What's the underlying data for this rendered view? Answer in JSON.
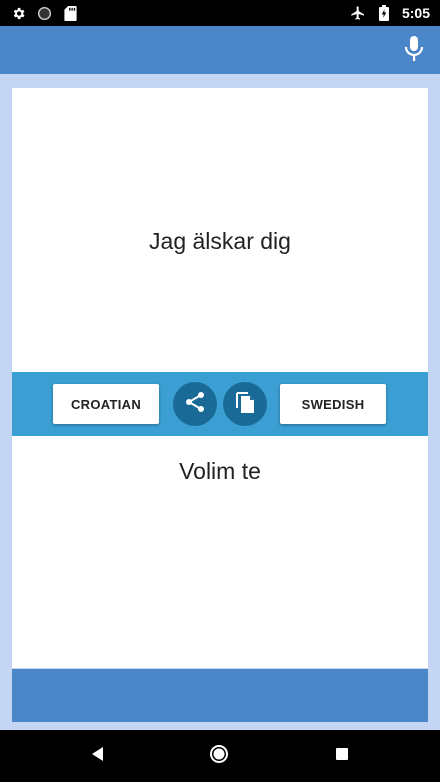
{
  "status_bar": {
    "time": "5:05",
    "icons_left": [
      "gear-icon",
      "circle-icon",
      "sd-card-icon"
    ],
    "icons_right": [
      "airplane-icon",
      "battery-icon"
    ]
  },
  "app_bar": {
    "icon": "microphone-icon",
    "color": "#4a86c8"
  },
  "source": {
    "text": "Jag älskar dig"
  },
  "toolbar": {
    "source_language": "CROATIAN",
    "target_language": "SWEDISH",
    "share_icon": "share-icon",
    "copy_icon": "copy-icon",
    "color": "#3b9fd4"
  },
  "target": {
    "text": "Volim te"
  },
  "nav_bar": {
    "icons": [
      "back-icon",
      "home-icon",
      "recent-apps-icon"
    ]
  }
}
